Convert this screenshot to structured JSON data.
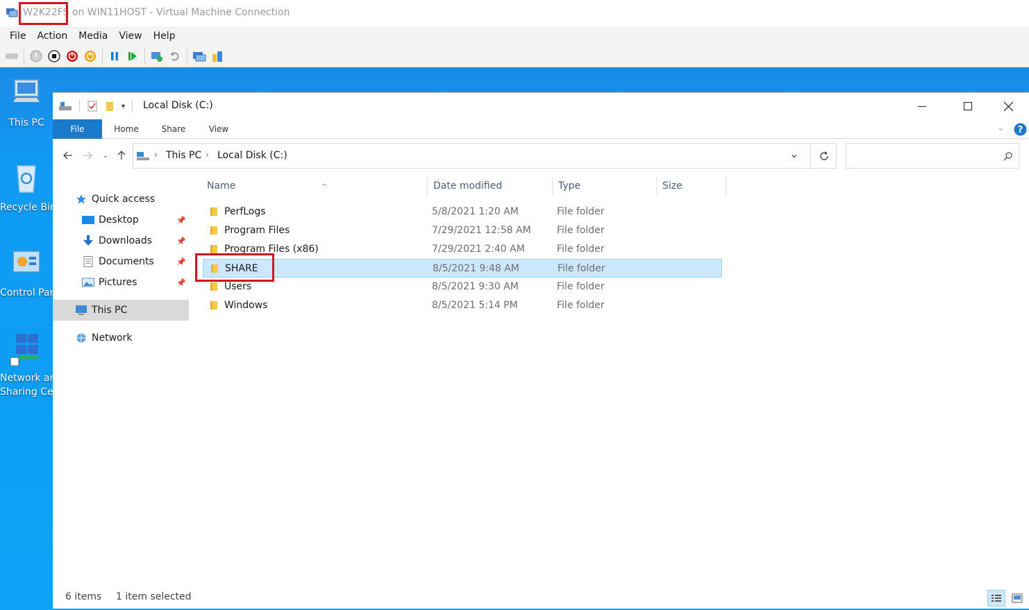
{
  "vm": {
    "title_host": "W2K22FS",
    "title_rest": " on WIN11HOST - Virtual Machine Connection",
    "menu": [
      "File",
      "Action",
      "Media",
      "View",
      "Help"
    ]
  },
  "desktop_icons": [
    {
      "label": "This PC"
    },
    {
      "label": "Recycle Bin"
    },
    {
      "label": "Control Panel"
    },
    {
      "label": "Network and"
    },
    {
      "label": "Sharing Center"
    }
  ],
  "explorer": {
    "title": "Local Disk (C:)",
    "ribbon_tabs": [
      "File",
      "Home",
      "Share",
      "View"
    ],
    "breadcrumb": [
      "This PC",
      "Local Disk (C:)"
    ],
    "nav": {
      "quick_access": "Quick access",
      "desktop": "Desktop",
      "downloads": "Downloads",
      "documents": "Documents",
      "pictures": "Pictures",
      "this_pc": "This PC",
      "network": "Network"
    },
    "columns": {
      "name": "Name",
      "date": "Date modified",
      "type": "Type",
      "size": "Size"
    },
    "files": [
      {
        "name": "PerfLogs",
        "date": "5/8/2021 1:20 AM",
        "type": "File folder"
      },
      {
        "name": "Program Files",
        "date": "7/29/2021 12:58 AM",
        "type": "File folder"
      },
      {
        "name": "Program Files (x86)",
        "date": "7/29/2021 2:40 AM",
        "type": "File folder"
      },
      {
        "name": "SHARE",
        "date": "8/5/2021 9:48 AM",
        "type": "File folder"
      },
      {
        "name": "Users",
        "date": "8/5/2021 9:30 AM",
        "type": "File folder"
      },
      {
        "name": "Windows",
        "date": "8/5/2021 5:14 PM",
        "type": "File folder"
      }
    ],
    "status": {
      "items": "6 items",
      "selected": "1 item selected"
    }
  },
  "colors": {
    "accent": "#1979ca",
    "highlight": "#d9101d",
    "selection": "#cce8ff",
    "desktop": "#0aa3f5"
  }
}
